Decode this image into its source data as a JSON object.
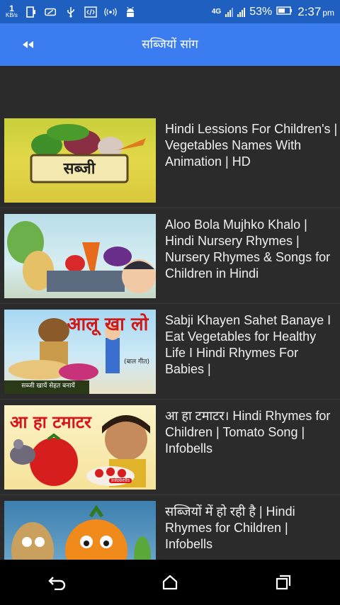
{
  "status_bar": {
    "net_speed_value": "1",
    "net_speed_unit": "KB/s",
    "network_type": "4G",
    "battery_percent": "53%",
    "time": "2:37",
    "ampm": "pm",
    "icons": [
      "sim-icon",
      "battery-saver-icon",
      "usb-icon",
      "code-icon",
      "hotspot-icon",
      "android-icon"
    ]
  },
  "app_bar": {
    "title": "सब्जियों सांग",
    "back_icon": "rewind-icon"
  },
  "videos": [
    {
      "title": "Hindi Lessions For Children's | Vegetables Names With Animation | HD",
      "thumbnail_text": "सब्जी"
    },
    {
      "title": "Aloo Bola Mujhko Khalo | Hindi Nursery Rhymes | Nursery Rhymes & Songs for Children in Hindi",
      "thumbnail_text": ""
    },
    {
      "title": "Sabji Khayen Sahet Banaye I Eat Vegetables for Healthy Life I Hindi Rhymes For Babies |",
      "thumbnail_text": "आलू खा लो",
      "thumbnail_subtext": "(बाल गीत)",
      "thumbnail_caption": "सब्जी खायें सेहत बनायें"
    },
    {
      "title": "आ हा टमाटर। Hindi Rhymes for Children | Tomato Song | Infobells",
      "thumbnail_text": "आ हा टमाटर",
      "thumbnail_brand": "Infobells"
    },
    {
      "title": "सब्जियों में हो रही है | Hindi Rhymes for Children | Infobells",
      "thumbnail_text": ""
    }
  ],
  "nav_bar": {
    "buttons": [
      "back-icon",
      "home-icon",
      "recents-icon"
    ]
  },
  "colors": {
    "status_bar": "#1f5fbf",
    "app_bar": "#3b7df0",
    "background": "#2b2b2b",
    "nav_bar": "#000000"
  }
}
